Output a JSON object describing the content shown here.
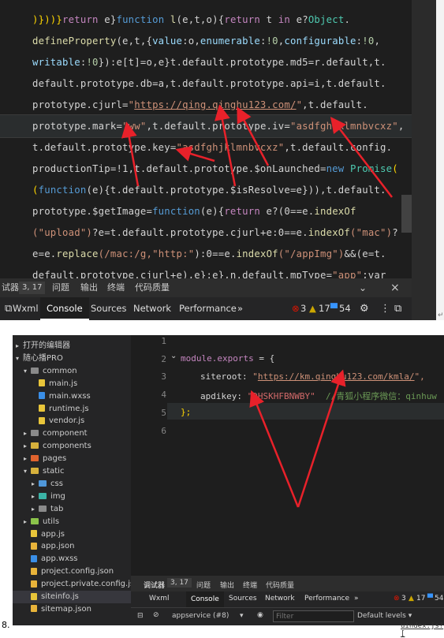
{
  "top": {
    "code_lines": [
      [
        {
          "t": ")}))}",
          "c": "y"
        },
        {
          "t": "return",
          "c": "k"
        },
        {
          "t": " e}"
        },
        {
          "t": "function",
          "c": "b"
        },
        {
          "t": " "
        },
        {
          "t": "l",
          "c": "f"
        },
        {
          "t": "(e,t,o){"
        },
        {
          "t": "return",
          "c": "k"
        },
        {
          "t": " t "
        },
        {
          "t": "in",
          "c": "k"
        },
        {
          "t": " e?"
        },
        {
          "t": "Object",
          "c": "c"
        },
        {
          "t": "."
        }
      ],
      [
        {
          "t": "defineProperty",
          "c": "f"
        },
        {
          "t": "(e,t,{"
        },
        {
          "t": "value",
          "c": "p"
        },
        {
          "t": ":o,"
        },
        {
          "t": "enumerable",
          "c": "p"
        },
        {
          "t": ":"
        },
        {
          "t": "!0",
          "c": "n"
        },
        {
          "t": ","
        },
        {
          "t": "configurable",
          "c": "p"
        },
        {
          "t": ":"
        },
        {
          "t": "!0",
          "c": "n"
        },
        {
          "t": ","
        }
      ],
      [
        {
          "t": "writable",
          "c": "p"
        },
        {
          "t": ":"
        },
        {
          "t": "!0",
          "c": "n"
        },
        {
          "t": "}):e[t]=o,e}t.default.prototype.md5=r.default,t."
        }
      ],
      [
        {
          "t": "default.prototype.db=a,t.default.prototype.api=i,t.default."
        }
      ],
      [
        {
          "t": "prototype.cjurl="
        },
        {
          "t": "\"",
          "c": "s"
        },
        {
          "t": "https://qing.qinghu123.com/",
          "c": "u"
        },
        {
          "t": "\"",
          "c": "s"
        },
        {
          "t": ",t.default."
        }
      ],
      [
        {
          "t": "prototype.mark="
        },
        {
          "t": "\"ww\"",
          "c": "s"
        },
        {
          "t": ",t.default.prototype.iv="
        },
        {
          "t": "\"asdfghjklmnbvcxz\"",
          "c": "s"
        },
        {
          "t": ","
        }
      ],
      [
        {
          "t": "t.default.prototype.key="
        },
        {
          "t": "\"asdfghjklmnbvcxz\"",
          "c": "s"
        },
        {
          "t": ",t.default.config."
        }
      ],
      [
        {
          "t": "productionTip=!1,t.default.prototype.$onLaunched="
        },
        {
          "t": "new",
          "c": "b"
        },
        {
          "t": " "
        },
        {
          "t": "Promise",
          "c": "c"
        },
        {
          "t": "(",
          "c": "y"
        }
      ],
      [
        {
          "t": "(",
          "c": "y"
        },
        {
          "t": "function",
          "c": "b"
        },
        {
          "t": "(e){t.default.prototype.$isResolve=e})),t.default."
        }
      ],
      [
        {
          "t": "prototype.$getImage="
        },
        {
          "t": "function",
          "c": "b"
        },
        {
          "t": "(e){"
        },
        {
          "t": "return",
          "c": "k"
        },
        {
          "t": " e?(0==e."
        },
        {
          "t": "indexOf",
          "c": "f"
        }
      ],
      [
        {
          "t": "(\"upload\")",
          "c": "s"
        },
        {
          "t": "?e=t.default.prototype.cjurl+e:0==e."
        },
        {
          "t": "indexOf",
          "c": "f"
        },
        {
          "t": "(\"mac\")",
          "c": "s"
        },
        {
          "t": "?"
        }
      ],
      [
        {
          "t": "e=e."
        },
        {
          "t": "replace",
          "c": "f"
        },
        {
          "t": "(/mac:/g,",
          "c": "s"
        },
        {
          "t": "\"http:\"",
          "c": "s"
        },
        {
          "t": "):0==e."
        },
        {
          "t": "indexOf",
          "c": "f"
        },
        {
          "t": "(\"/appImg\")",
          "c": "s"
        },
        {
          "t": "&&(e=t."
        }
      ],
      [
        {
          "t": "default.prototype.cjurl+e),e}:e},n.default.mpType="
        },
        {
          "t": "\"app\"",
          "c": "s"
        },
        {
          "t": ";var"
        }
      ]
    ],
    "toolbar": {
      "debugger_label": "试器",
      "position": "3, 17",
      "issues": "问题",
      "output": "输出",
      "terminal": "终端",
      "quality": "代码质量",
      "close": "×"
    },
    "tabs": [
      "Wxml",
      "Console",
      "Sources",
      "Network",
      "Performance"
    ],
    "active_tab": "Console",
    "more": "»",
    "errors": "3",
    "warnings": "17",
    "infos": "54"
  },
  "bottom": {
    "tree": [
      {
        "label": "打开的编辑器",
        "indent": 0,
        "arrow": "▸",
        "kind": "none"
      },
      {
        "label": "随心播PRO",
        "indent": 0,
        "arrow": "▾",
        "kind": "none"
      },
      {
        "label": "common",
        "indent": 1,
        "arrow": "▾",
        "kind": "folder"
      },
      {
        "label": "main.js",
        "indent": 2,
        "arrow": "",
        "kind": "js"
      },
      {
        "label": "main.wxss",
        "indent": 2,
        "arrow": "",
        "kind": "wxss"
      },
      {
        "label": "runtime.js",
        "indent": 2,
        "arrow": "",
        "kind": "js"
      },
      {
        "label": "vendor.js",
        "indent": 2,
        "arrow": "",
        "kind": "js"
      },
      {
        "label": "component",
        "indent": 1,
        "arrow": "▸",
        "kind": "folder"
      },
      {
        "label": "components",
        "indent": 1,
        "arrow": "▸",
        "kind": "folderY"
      },
      {
        "label": "pages",
        "indent": 1,
        "arrow": "▸",
        "kind": "folderR"
      },
      {
        "label": "static",
        "indent": 1,
        "arrow": "▾",
        "kind": "folderY"
      },
      {
        "label": "css",
        "indent": 2,
        "arrow": "▸",
        "kind": "folderB"
      },
      {
        "label": "img",
        "indent": 2,
        "arrow": "▸",
        "kind": "folderT"
      },
      {
        "label": "tab",
        "indent": 2,
        "arrow": "▸",
        "kind": "folder"
      },
      {
        "label": "utils",
        "indent": 1,
        "arrow": "▸",
        "kind": "folderG"
      },
      {
        "label": "app.js",
        "indent": 1,
        "arrow": "",
        "kind": "js"
      },
      {
        "label": "app.json",
        "indent": 1,
        "arrow": "",
        "kind": "json"
      },
      {
        "label": "app.wxss",
        "indent": 1,
        "arrow": "",
        "kind": "wxss"
      },
      {
        "label": "project.config.json",
        "indent": 1,
        "arrow": "",
        "kind": "json"
      },
      {
        "label": "project.private.config.js...",
        "indent": 1,
        "arrow": "",
        "kind": "json"
      },
      {
        "label": "siteinfo.js",
        "indent": 1,
        "arrow": "",
        "kind": "js"
      },
      {
        "label": "sitemap.json",
        "indent": 1,
        "arrow": "",
        "kind": "json"
      }
    ],
    "selected_index": 20,
    "line_numbers": [
      "1",
      "2",
      "3",
      "4",
      "5",
      "6"
    ],
    "code": {
      "l2_kw": "module.exports",
      "l2_rest": " = {",
      "l3_key": "siteroot: ",
      "l3_url": "https://km.qinghu123.com/kmla/",
      "l3_rest": "\",",
      "l4_key": "apdikey: ",
      "l4_val": "\"DHSKHFBNWBY\"",
      "l4_comment": "//青狐小程序微信：qinhuw",
      "l5": "};"
    },
    "toolbar": {
      "debugger_label": "调试器",
      "position": "3, 17",
      "issues": "问题",
      "output": "输出",
      "terminal": "终端",
      "quality": "代码质量"
    },
    "tabs": [
      "Wxml",
      "Console",
      "Sources",
      "Network",
      "Performance"
    ],
    "active_tab": "Console",
    "more": "»",
    "errors": "3",
    "warnings": "17",
    "infos": "54",
    "console_context": "appservice (#8)",
    "filter_placeholder": "Filter",
    "levels": "Default levels ▾"
  },
  "figure_number": "8.",
  "footer_link": "uindex.js? [",
  "colors": {
    "bg": "#1e1e1e",
    "arrow": "#e8212a",
    "error": "#e51400",
    "warning": "#cca700",
    "info": "#3794ff"
  }
}
